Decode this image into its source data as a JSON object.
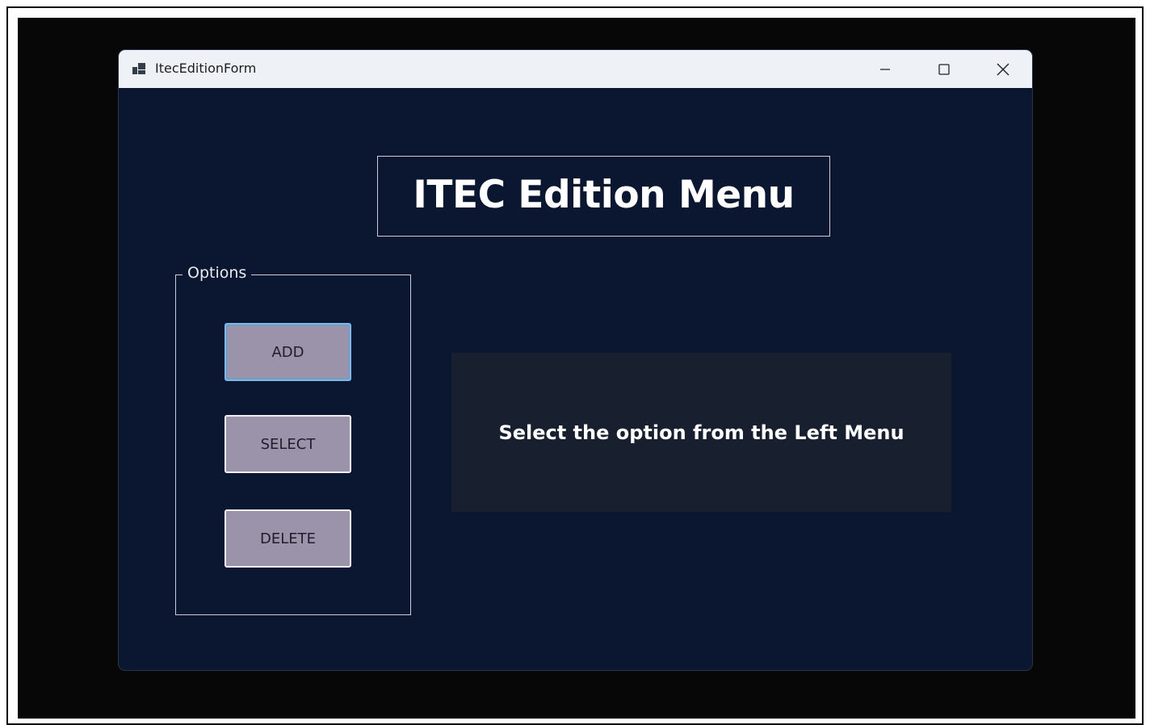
{
  "window": {
    "title": "ItecEditionForm",
    "icon": "app-form-icon",
    "controls": {
      "minimize": "minimize-icon",
      "maximize": "maximize-icon",
      "close": "close-icon"
    }
  },
  "header": {
    "title": "ITEC Edition Menu"
  },
  "options": {
    "legend": "Options",
    "buttons": {
      "add": "ADD",
      "select": "SELECT",
      "delete": "DELETE"
    }
  },
  "panel": {
    "message": "Select the option from the Left Menu"
  },
  "colors": {
    "window_background": "#0b1730",
    "button_background": "#9a93aa",
    "panel_background": "#18202f",
    "titlebar_background": "#eef2f7"
  }
}
